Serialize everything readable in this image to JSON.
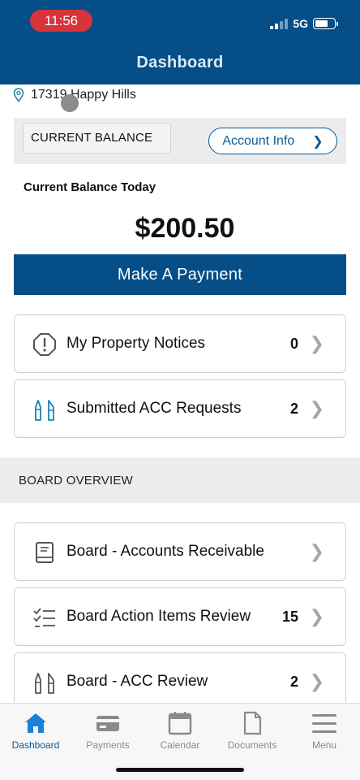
{
  "status_bar": {
    "time": "11:56",
    "network": "5G"
  },
  "header": {
    "title": "Dashboard"
  },
  "address": {
    "text": "17319 Happy Hills"
  },
  "balance": {
    "current_balance_label": "CURRENT BALANCE",
    "account_info_label": "Account Info",
    "today_label": "Current Balance Today",
    "amount": "$200.50"
  },
  "payment": {
    "button_label": "Make A Payment"
  },
  "cards": [
    {
      "label": "My Property Notices",
      "count": "0",
      "icon": "warning-octagon-icon"
    },
    {
      "label": "Submitted ACC Requests",
      "count": "2",
      "icon": "tools-icon"
    }
  ],
  "board": {
    "section_title": "BOARD OVERVIEW",
    "items": [
      {
        "label": "Board - Accounts Receivable",
        "count": "",
        "icon": "book-icon"
      },
      {
        "label": "Board Action Items Review",
        "count": "15",
        "icon": "checklist-icon"
      },
      {
        "label": "Board - ACC Review",
        "count": "2",
        "icon": "tools-icon"
      }
    ]
  },
  "tabs": [
    {
      "label": "Dashboard",
      "icon": "home-icon",
      "active": true
    },
    {
      "label": "Payments",
      "icon": "credit-card-icon"
    },
    {
      "label": "Calendar",
      "icon": "calendar-icon"
    },
    {
      "label": "Documents",
      "icon": "document-icon"
    },
    {
      "label": "Menu",
      "icon": "menu-icon"
    }
  ],
  "colors": {
    "brand": "#054e87",
    "time_pill": "#d8333a",
    "active_tab": "#0b5a95"
  }
}
